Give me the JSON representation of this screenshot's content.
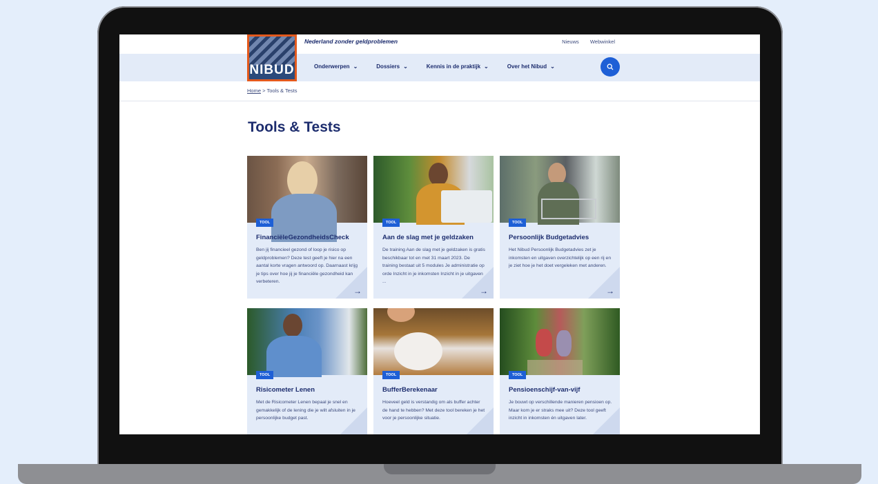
{
  "header": {
    "tagline": "Nederland zonder geldproblemen",
    "links": [
      "Nieuws",
      "Webwinkel"
    ],
    "logo_text": "NIBUD"
  },
  "nav": [
    {
      "label": "Onderwerpen"
    },
    {
      "label": "Dossiers"
    },
    {
      "label": "Kennis in de praktijk"
    },
    {
      "label": "Over het Nibud"
    }
  ],
  "breadcrumb": {
    "home": "Home",
    "sep": ">",
    "current": "Tools & Tests"
  },
  "page": {
    "title": "Tools & Tests"
  },
  "cards": [
    {
      "badge": "TOOL",
      "title": "FinanciëleGezondheidsCheck",
      "desc": "Ben jij financieel gezond of loop je risico op geldproblemen? Deze test geeft je hier na een aantal korte vragen antwoord op. Daarnaast krijg je tips over hoe jij je financiële gezondheid kan verbeteren."
    },
    {
      "badge": "TOOL",
      "title": "Aan de slag met je geldzaken",
      "desc": "De training Aan de slag met je geldzaken is gratis beschikbaar tot en met 31 maart 2023. De training bestaat uit 5 modules Je administratie op orde Inzicht in je inkomsten Inzicht in je uitgaven ..."
    },
    {
      "badge": "TOOL",
      "title": "Persoonlijk Budgetadvies",
      "desc": "Het Nibud Persoonlijk Budgetadvies zet je inkomsten en uitgaven overzichtelijk op een rij en je ziet hoe je het doet vergeleken met anderen."
    },
    {
      "badge": "TOOL",
      "title": "Risicometer Lenen",
      "desc": "Met de Risicometer Lenen bepaal je snel en gemakkelijk of de lening die je wilt afsluiten in je persoonlijke budget past."
    },
    {
      "badge": "TOOL",
      "title": "BufferBerekenaar",
      "desc": "Hoeveel geld is verstandig om als buffer achter de hand te hebben? Met deze tool bereken je het voor je persoonlijke situatie."
    },
    {
      "badge": "TOOL",
      "title": "Pensioenschijf-van-vijf",
      "desc": "Je bouwt op verschillende manieren pensioen op. Maar kom je er straks mee uit? Deze tool geeft inzicht in inkomsten én uitgaven later."
    }
  ],
  "icons": {
    "arrow": "arrow-right-icon",
    "search": "search-icon",
    "chevron": "chevron-down-icon"
  },
  "colors": {
    "brand_navy": "#1d2d6e",
    "accent_blue": "#1e5fd6",
    "logo_orange": "#e3591c",
    "nav_bg": "#e3ebf8",
    "background": "#e4eefb"
  }
}
